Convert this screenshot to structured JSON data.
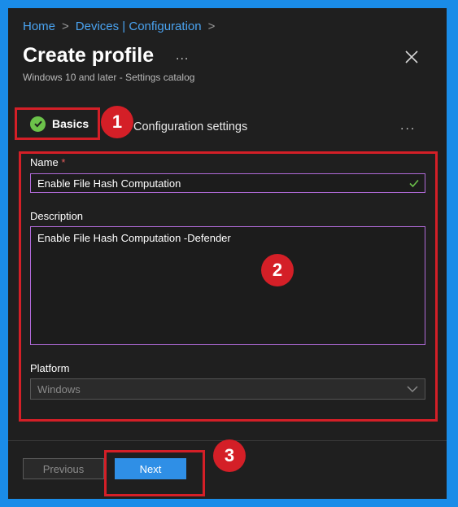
{
  "breadcrumb": {
    "items": [
      "Home",
      "Devices | Configuration"
    ],
    "separator": ">"
  },
  "header": {
    "title": "Create profile",
    "more_label": "...",
    "subtitle": "Windows 10 and later - Settings catalog"
  },
  "steps": {
    "basics_label": "Basics",
    "config_label": "Configuration settings",
    "more_label": "..."
  },
  "annotations": {
    "badge1": "1",
    "badge2": "2",
    "badge3": "3"
  },
  "form": {
    "name_label": "Name",
    "required_mark": "*",
    "name_value": "Enable File Hash Computation",
    "description_label": "Description",
    "description_value": "Enable File Hash Computation  -Defender",
    "platform_label": "Platform",
    "platform_value": "Windows"
  },
  "footer": {
    "previous_label": "Previous",
    "next_label": "Next"
  },
  "colors": {
    "accent": "#1a8ce8",
    "annotation_red": "#d41f27",
    "success_green": "#6cc24a",
    "input_border": "#b06ad8",
    "primary_button": "#2f8fe6"
  }
}
